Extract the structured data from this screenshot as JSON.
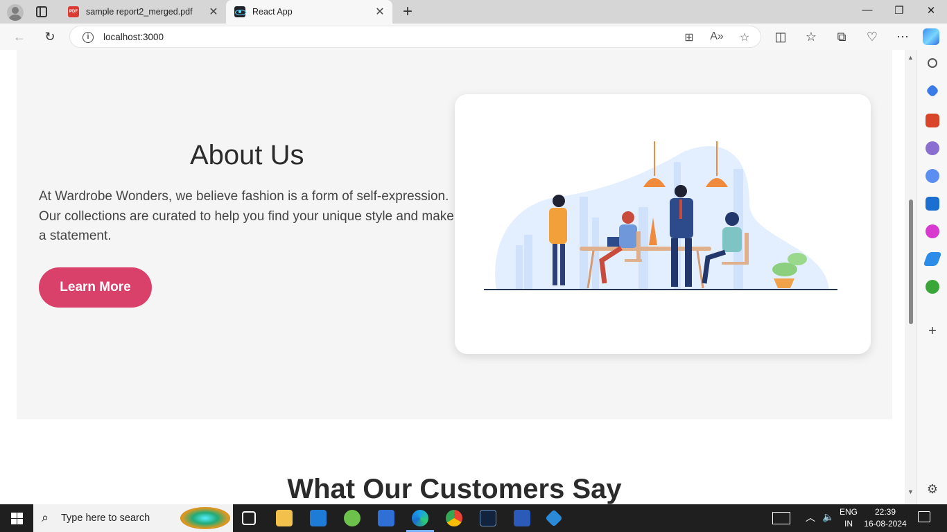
{
  "browser": {
    "tabs": [
      {
        "title": "sample report2_merged.pdf",
        "icon": "pdf-icon",
        "active": false
      },
      {
        "title": "React App",
        "icon": "react-icon",
        "active": true
      }
    ],
    "url": "localhost:3000",
    "new_tab_label": "+",
    "close_label": "✕"
  },
  "about": {
    "title": "About Us",
    "body": "At Wardrobe Wonders, we believe fashion is a form of self-expression. Our collections are curated to help you find your unique style and make a statement.",
    "button_label": "Learn More",
    "button_color": "#d9416b"
  },
  "testimonials": {
    "title": "What Our Customers Say"
  },
  "taskbar": {
    "search_placeholder": "Type here to search",
    "lang_line1": "ENG",
    "lang_line2": "IN",
    "time": "22:39",
    "date": "16-08-2024"
  }
}
